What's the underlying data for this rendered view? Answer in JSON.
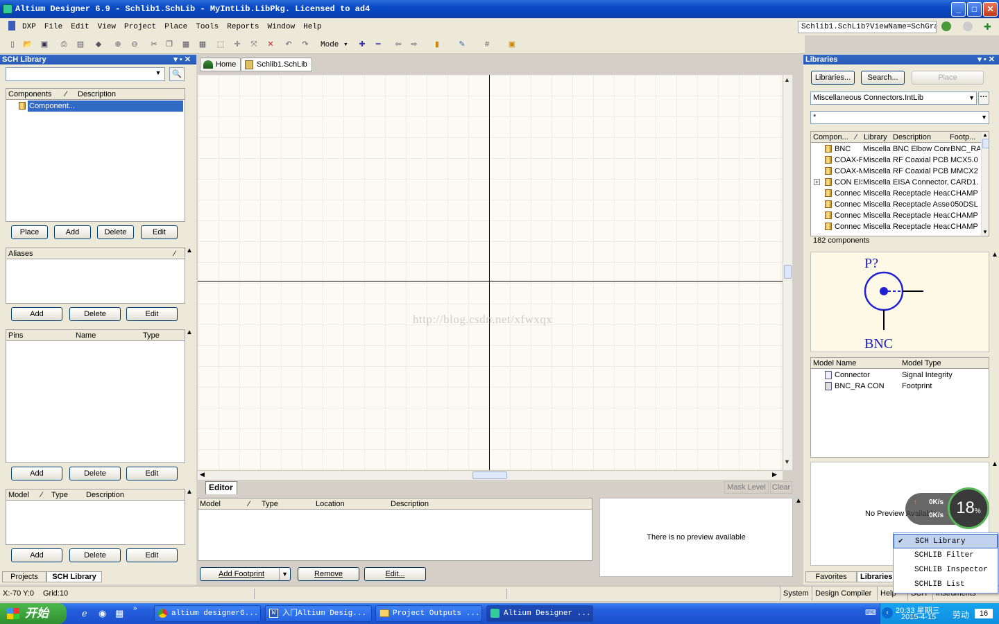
{
  "window": {
    "title": "Altium Designer 6.9 - Schlib1.SchLib - MyIntLib.LibPkg. Licensed to ad4",
    "min": "_",
    "max": "□",
    "close": "✕"
  },
  "menu": [
    "DXP",
    "File",
    "Edit",
    "View",
    "Project",
    "Place",
    "Tools",
    "Reports",
    "Window",
    "Help"
  ],
  "address": {
    "value": "Schlib1.SchLib?ViewName=SchGra"
  },
  "toolbar": {
    "mode_label": "Mode"
  },
  "sch_panel": {
    "title": "SCH Library",
    "components": {
      "headers": [
        "Components",
        "Description"
      ],
      "items": [
        "Component..."
      ]
    },
    "comp_buttons": [
      "Place",
      "Add",
      "Delete",
      "Edit"
    ],
    "aliases": {
      "header": "Aliases"
    },
    "alias_buttons": [
      "Add",
      "Delete",
      "Edit"
    ],
    "pins": {
      "headers": [
        "Pins",
        "Name",
        "Type"
      ]
    },
    "pin_buttons": [
      "Add",
      "Delete",
      "Edit"
    ],
    "model": {
      "headers": [
        "Model",
        "Type",
        "Description"
      ]
    },
    "model_buttons": [
      "Add",
      "Delete",
      "Edit"
    ],
    "bottom_tabs": [
      "Projects",
      "SCH Library"
    ]
  },
  "doc_tabs": [
    "Home",
    "Schlib1.SchLib"
  ],
  "watermark": "http://blog.csdn.net/xfwxqx",
  "editor": {
    "tab": "Editor",
    "mask_level": "Mask Level",
    "clear": "Clear",
    "headers": [
      "Model",
      "Type",
      "Location",
      "Description"
    ],
    "preview": "There is no preview available",
    "buttons": {
      "add_footprint": "Add Footprint",
      "remove": "Remove",
      "edit": "Edit..."
    }
  },
  "libraries": {
    "title": "Libraries",
    "buttons": [
      "Libraries...",
      "Search...",
      "Place"
    ],
    "selected_lib": "Miscellaneous Connectors.IntLib",
    "filter": "*",
    "headers": [
      "Compon...",
      "Library",
      "Description",
      "Footp..."
    ],
    "rows": [
      [
        "BNC",
        "Miscella",
        "BNC Elbow Conn",
        "BNC_RA"
      ],
      [
        "COAX-F",
        "Miscella",
        "RF Coaxial PCB M",
        "MCX5.0"
      ],
      [
        "COAX-M",
        "Miscella",
        "RF Coaxial PCB M",
        "MMCX2"
      ],
      [
        "CON EISA",
        "Miscella",
        "EISA Connector,",
        "CARD1."
      ],
      [
        "Connec",
        "Miscella",
        "Receptacle Head",
        "CHAMP"
      ],
      [
        "Connec",
        "Miscella",
        "Receptacle Asse",
        "050DSL"
      ],
      [
        "Connec",
        "Miscella",
        "Receptacle Head",
        "CHAMP"
      ],
      [
        "Connec",
        "Miscella",
        "Receptacle Head",
        "CHAMP"
      ]
    ],
    "count": "182 components",
    "preview": {
      "designator": "P?",
      "comment": "BNC"
    },
    "models": {
      "headers": [
        "Model Name",
        "Model Type"
      ],
      "rows": [
        [
          "Connector",
          "Signal Integrity"
        ],
        [
          "BNC_RA CON",
          "Footprint"
        ]
      ]
    },
    "no_preview": "No Preview Available",
    "bottom_tabs": [
      "Favorites",
      "Libraries"
    ]
  },
  "net_widget": {
    "up": "0K/s",
    "down": "0K/s",
    "percent": "18",
    "unit": "%"
  },
  "context_menu": [
    "SCH Library",
    "SCHLIB Filter",
    "SCHLIB Inspector",
    "SCHLIB List"
  ],
  "status": {
    "coords": "X:-70 Y:0",
    "grid": "Grid:10",
    "items": [
      "System",
      "Design Compiler",
      "Help",
      "SCH",
      "Instruments"
    ]
  },
  "taskbar": {
    "start": "开始",
    "tasks": [
      "altium designer6...",
      "入门Altium Desig...",
      "Project Outputs ...",
      "Altium Designer ..."
    ],
    "clock": {
      "time": "20:33 星期三",
      "date": "2015-4-15"
    },
    "ime": "劳动",
    "num": "16"
  }
}
